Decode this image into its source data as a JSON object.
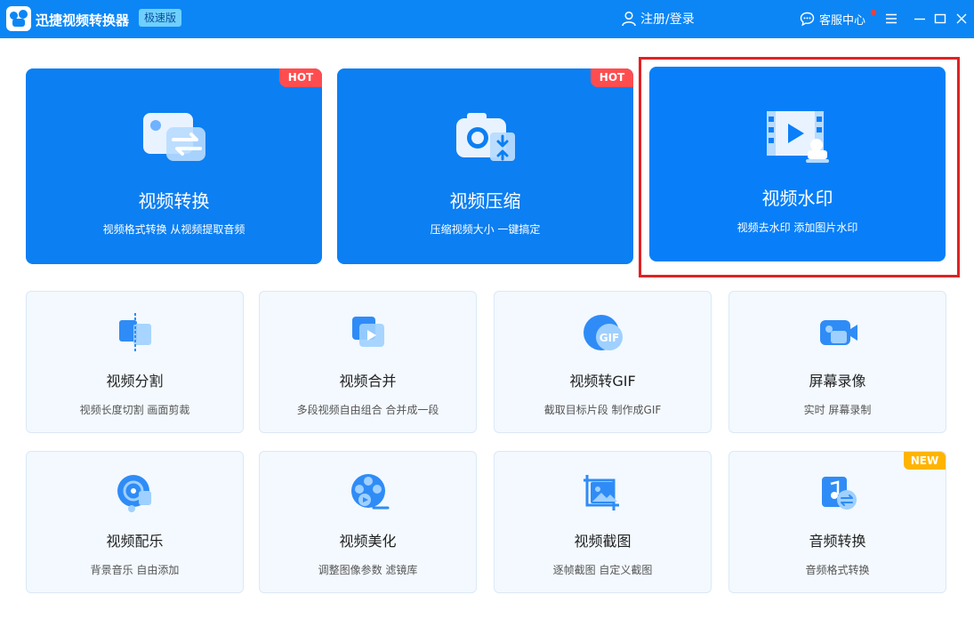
{
  "app": {
    "title": "迅捷视频转换器",
    "edition": "极速版"
  },
  "header": {
    "login": "注册/登录",
    "service": "客服中心"
  },
  "featured": [
    {
      "title": "视频转换",
      "desc": "视频格式转换 从视频提取音频",
      "badge": "HOT",
      "icon": "video-convert-icon"
    },
    {
      "title": "视频压缩",
      "desc": "压缩视频大小 一键搞定",
      "badge": "HOT",
      "icon": "camera-compress-icon"
    },
    {
      "title": "视频水印",
      "desc": "视频去水印 添加图片水印",
      "badge": "",
      "icon": "video-stamp-icon"
    }
  ],
  "tools": [
    {
      "title": "视频分割",
      "desc": "视频长度切割 画面剪裁",
      "icon": "split-icon"
    },
    {
      "title": "视频合并",
      "desc": "多段视频自由组合 合并成一段",
      "icon": "merge-icon"
    },
    {
      "title": "视频转GIF",
      "desc": "截取目标片段 制作成GIF",
      "icon": "gif-icon"
    },
    {
      "title": "屏幕录像",
      "desc": "实时 屏幕录制",
      "icon": "screen-record-icon"
    },
    {
      "title": "视频配乐",
      "desc": "背景音乐 自由添加",
      "icon": "music-icon"
    },
    {
      "title": "视频美化",
      "desc": "调整图像参数 滤镜库",
      "icon": "film-reel-icon"
    },
    {
      "title": "视频截图",
      "desc": "逐帧截图 自定义截图",
      "icon": "screenshot-icon"
    },
    {
      "title": "音频转换",
      "desc": "音频格式转换",
      "icon": "audio-convert-icon",
      "badge": "NEW"
    }
  ],
  "colors": {
    "titlebar": "#0c86f5",
    "card_blue": "#0c7ff2",
    "hot": "#ff4d4f",
    "new": "#ffb400",
    "highlight": "#e02222"
  }
}
